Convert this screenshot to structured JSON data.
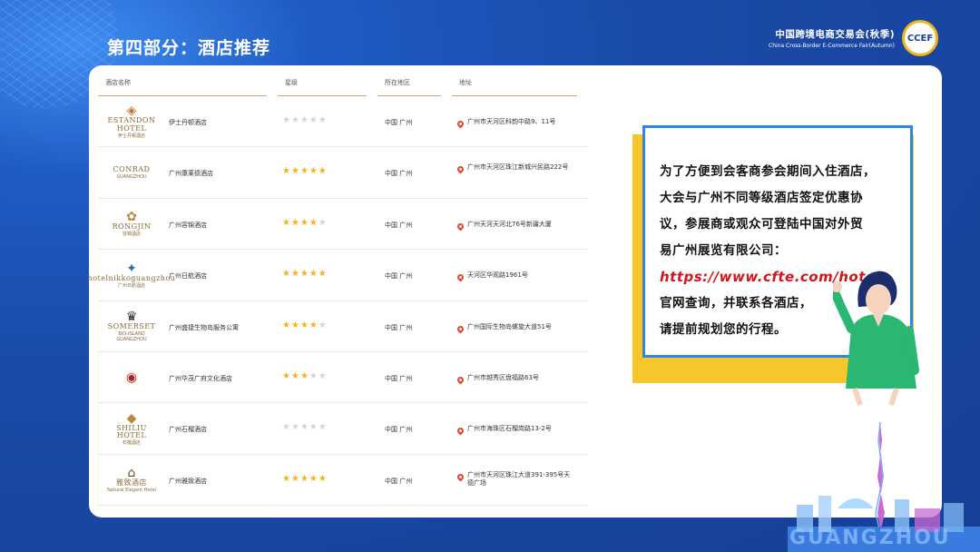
{
  "slide_title": "第四部分：酒店推荐",
  "brand": {
    "cn": "中国跨境电商交易会(秋季)",
    "en": "China Cross-Border E-Commerce Fair(Autumn)",
    "logo": "CCEF"
  },
  "table": {
    "headers": [
      "酒店名称",
      "星级",
      "所在地区",
      "地址"
    ],
    "rows": [
      {
        "logo_main": "ESTANDON HOTEL",
        "logo_sub": "伊士丹顿酒店",
        "name": "伊士丹顿酒店",
        "stars": 0,
        "area": "中国 广州",
        "address": "广州市天河区科韵中路9、11号"
      },
      {
        "logo_main": "CONRAD",
        "logo_sub": "GUANGZHOU",
        "name": "广州康莱德酒店",
        "stars": 5,
        "area": "中国 广州",
        "address": "广州市天河区珠江新城兴民路222号"
      },
      {
        "logo_main": "RONGJIN",
        "logo_sub": "容锦酒店",
        "name": "广州容锦酒店",
        "stars": 4,
        "area": "中国 广州",
        "address": "广州天河天河北76号新疆大厦"
      },
      {
        "logo_main": "hotelnikkoguangzhou",
        "logo_sub": "广州日航酒店",
        "name": "广州日航酒店",
        "stars": 5,
        "area": "中国 广州",
        "address": "天河区华观路1961号"
      },
      {
        "logo_main": "SOMERSET",
        "logo_sub": "BIO-ISLAND GUANGZHOU",
        "name": "广州盛捷生物岛服务公寓",
        "stars": 4,
        "area": "中国 广州",
        "address": "广州国际生物岛螺旋大道51号"
      },
      {
        "logo_main": "",
        "logo_sub": "",
        "name": "广州华茂广府文化酒店",
        "stars": 3,
        "area": "中国 广州",
        "address": "广州市越秀区盘福路63号"
      },
      {
        "logo_main": "SHILIU HOTEL",
        "logo_sub": "石榴酒店",
        "name": "广州石榴酒店",
        "stars": 0,
        "area": "中国 广州",
        "address": "广州市海珠区石榴岗路13-2号"
      },
      {
        "logo_main": "雅致酒店",
        "logo_sub": "Natural Elegant Hotel",
        "name": "广州雅致酒店",
        "stars": 5,
        "area": "中国 广州",
        "address": "广州市天河区珠江大道391-395号天德广场"
      }
    ]
  },
  "info": {
    "lines": [
      "为了方便到会客商参会期间入住酒店，",
      "大会与广州不同等级酒店签定优惠协",
      "议，参展商或观众可登陆中国对外贸",
      "易广州展览有限公司："
    ],
    "link": "https://www.cfte.com/hotel",
    "lines_after": [
      "官网查询，并联系各酒店，",
      "请提前规划您的行程。"
    ]
  },
  "city_word": "GUANGZHOU",
  "colors": {
    "background": "#1b4fb3",
    "star": "#f3b31b",
    "link": "#d4141b",
    "info_border": "#2c87e8",
    "info_shadow": "#f6c62c"
  }
}
